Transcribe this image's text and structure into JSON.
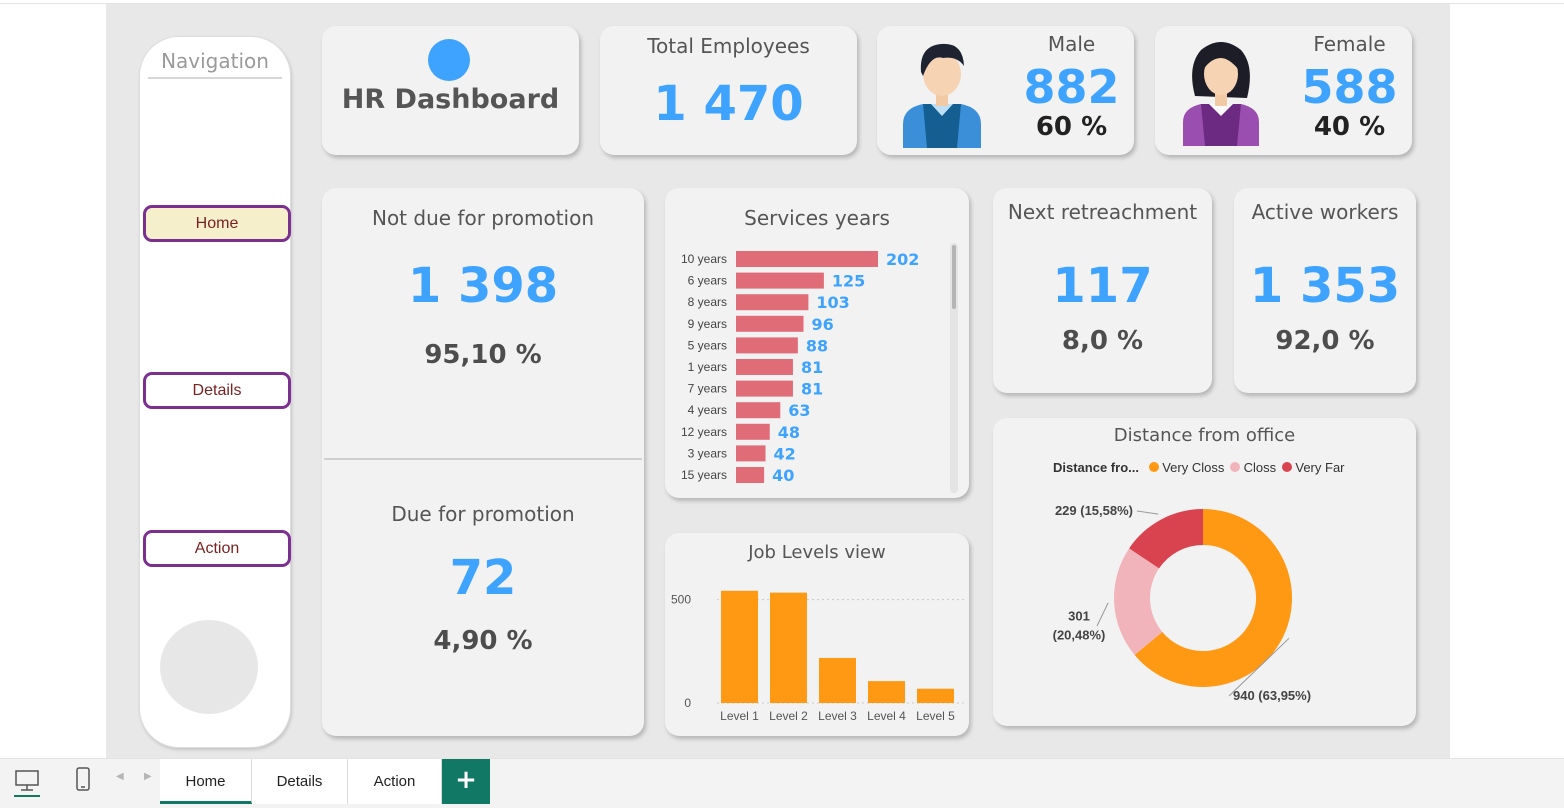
{
  "navigation": {
    "title": "Navigation",
    "buttons": [
      {
        "label": "Home",
        "active": true
      },
      {
        "label": "Details",
        "active": false
      },
      {
        "label": "Action",
        "active": false
      }
    ]
  },
  "header": {
    "title": "HR Dashboard",
    "total_employees_label": "Total Employees",
    "total_employees_value": "1 470",
    "male_label": "Male",
    "male_value": "882",
    "male_pct": "60 %",
    "female_label": "Female",
    "female_value": "588",
    "female_pct": "40 %"
  },
  "promotion": {
    "not_due_label": "Not due for promotion",
    "not_due_value": "1 398",
    "not_due_pct": "95,10 %",
    "due_label": "Due for promotion",
    "due_value": "72",
    "due_pct": "4,90 %"
  },
  "retirement": {
    "label": "Next retreachment",
    "value": "117",
    "pct": "8,0 %"
  },
  "active": {
    "label": "Active workers",
    "value": "1 353",
    "pct": "92,0 %"
  },
  "colors": {
    "accent": "#3ea2ff",
    "bar_service": "#e06c78",
    "bar_level": "#ff9812",
    "very_close": "#ff9812",
    "close": "#f1b4ba",
    "very_far": "#d9434f",
    "tab_green": "#117865"
  },
  "chart_data": [
    {
      "type": "bar",
      "orientation": "horizontal",
      "title": "Services years",
      "categories": [
        "10 years",
        "6 years",
        "8 years",
        "9 years",
        "5 years",
        "1 years",
        "7 years",
        "4 years",
        "12 years",
        "3 years",
        "15 years"
      ],
      "values": [
        202,
        125,
        103,
        96,
        88,
        81,
        81,
        63,
        48,
        42,
        40
      ]
    },
    {
      "type": "bar",
      "title": "Job Levels view",
      "categories": [
        "Level 1",
        "Level 2",
        "Level 3",
        "Level 4",
        "Level 5"
      ],
      "values": [
        543,
        534,
        218,
        106,
        69
      ],
      "yticks": [
        "0",
        "500"
      ],
      "ylim": [
        0,
        600
      ]
    },
    {
      "type": "pie",
      "title": "Distance from office",
      "legend_title": "Distance fro...",
      "legend_position": "top",
      "categories": [
        "Very Closs",
        "Closs",
        "Very Far"
      ],
      "values": [
        940,
        301,
        229
      ],
      "labels": [
        "940 (63,95%)",
        "301 (20,48%)",
        "229 (15,58%)"
      ]
    }
  ],
  "bottom_tabs": [
    "Home",
    "Details",
    "Action"
  ],
  "bottom_icons": [
    "desktop-icon",
    "phone-icon"
  ],
  "add_tab_label": "+"
}
